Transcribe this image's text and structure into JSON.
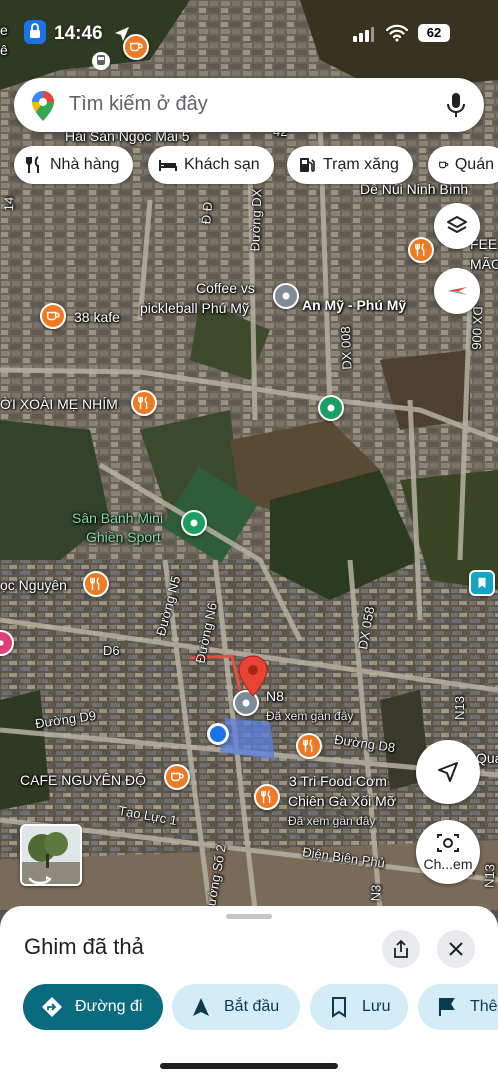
{
  "status_bar": {
    "time": "14:46",
    "battery": "62"
  },
  "search": {
    "placeholder": "Tìm kiếm ở đây"
  },
  "chips": [
    "Nhà hàng",
    "Khách sạn",
    "Trạm xăng",
    "Quán"
  ],
  "map_labels": {
    "hai_san": "Hải Sản Ngọc Mai 5",
    "te_tea": "te tea",
    "de_nui": "Dê Núi Ninh Bình",
    "feb": "FEE",
    "mao": "MÃO &",
    "coffee": "Coffee vs",
    "pickleball": "pickleball Phú Mỹ",
    "an_my": "An Mỹ - Phú Mỹ",
    "kafe": "38 kafe",
    "xoai": "ỜI XOÀI MẸ NHÍM",
    "san_banh_1": "Sân Banh Mini",
    "san_banh_2": "Ghiền Sport",
    "ngoc_nguyen": "ọc Nguyên",
    "n8": "N8",
    "da_xem_1": "Đã xem gần đây",
    "cafe_nguyen_do": "CAFE NGUYÊN ĐỘ",
    "tri_food_1": "3 Tri Food Cơm",
    "tri_food_2": "Chiên Gà Xối Mỡ",
    "da_xem_2": "Đã xem gần đây",
    "qua": "Quá",
    "em": "em"
  },
  "road_labels": {
    "d5": "Đ Đ",
    "duong_dx": "Đường DX",
    "dx_008": "DX 008",
    "dx_006": "DX 006",
    "duong_n5": "Đường N5",
    "duong_n6": "Đường N6",
    "d6": "D6",
    "dx_058": "DX 058",
    "duong_d9": "Đường D9",
    "duong_d8": "Đường D8",
    "n13": "N13",
    "tao_luc": "Tạo Lực 1",
    "duong_so2": "Đường Số 2",
    "dien_bien_phu": "Điện Biên Phủ",
    "n3": "N3",
    "n13b": "N13",
    "num14": "14",
    "num42": "42"
  },
  "street_view": {
    "label": "Ch...em"
  },
  "bottom_sheet": {
    "title": "Ghim đã thả",
    "actions": [
      "Đường đi",
      "Bắt đầu",
      "Lưu",
      "Thê"
    ]
  },
  "colors": {
    "accent_dark": "#0b6b7e",
    "accent_light": "#d3ecf7",
    "pin_red": "#ea4335",
    "poi_orange": "#f07a22",
    "poi_green": "#1a9e62",
    "location_blue": "#1a73e8"
  }
}
